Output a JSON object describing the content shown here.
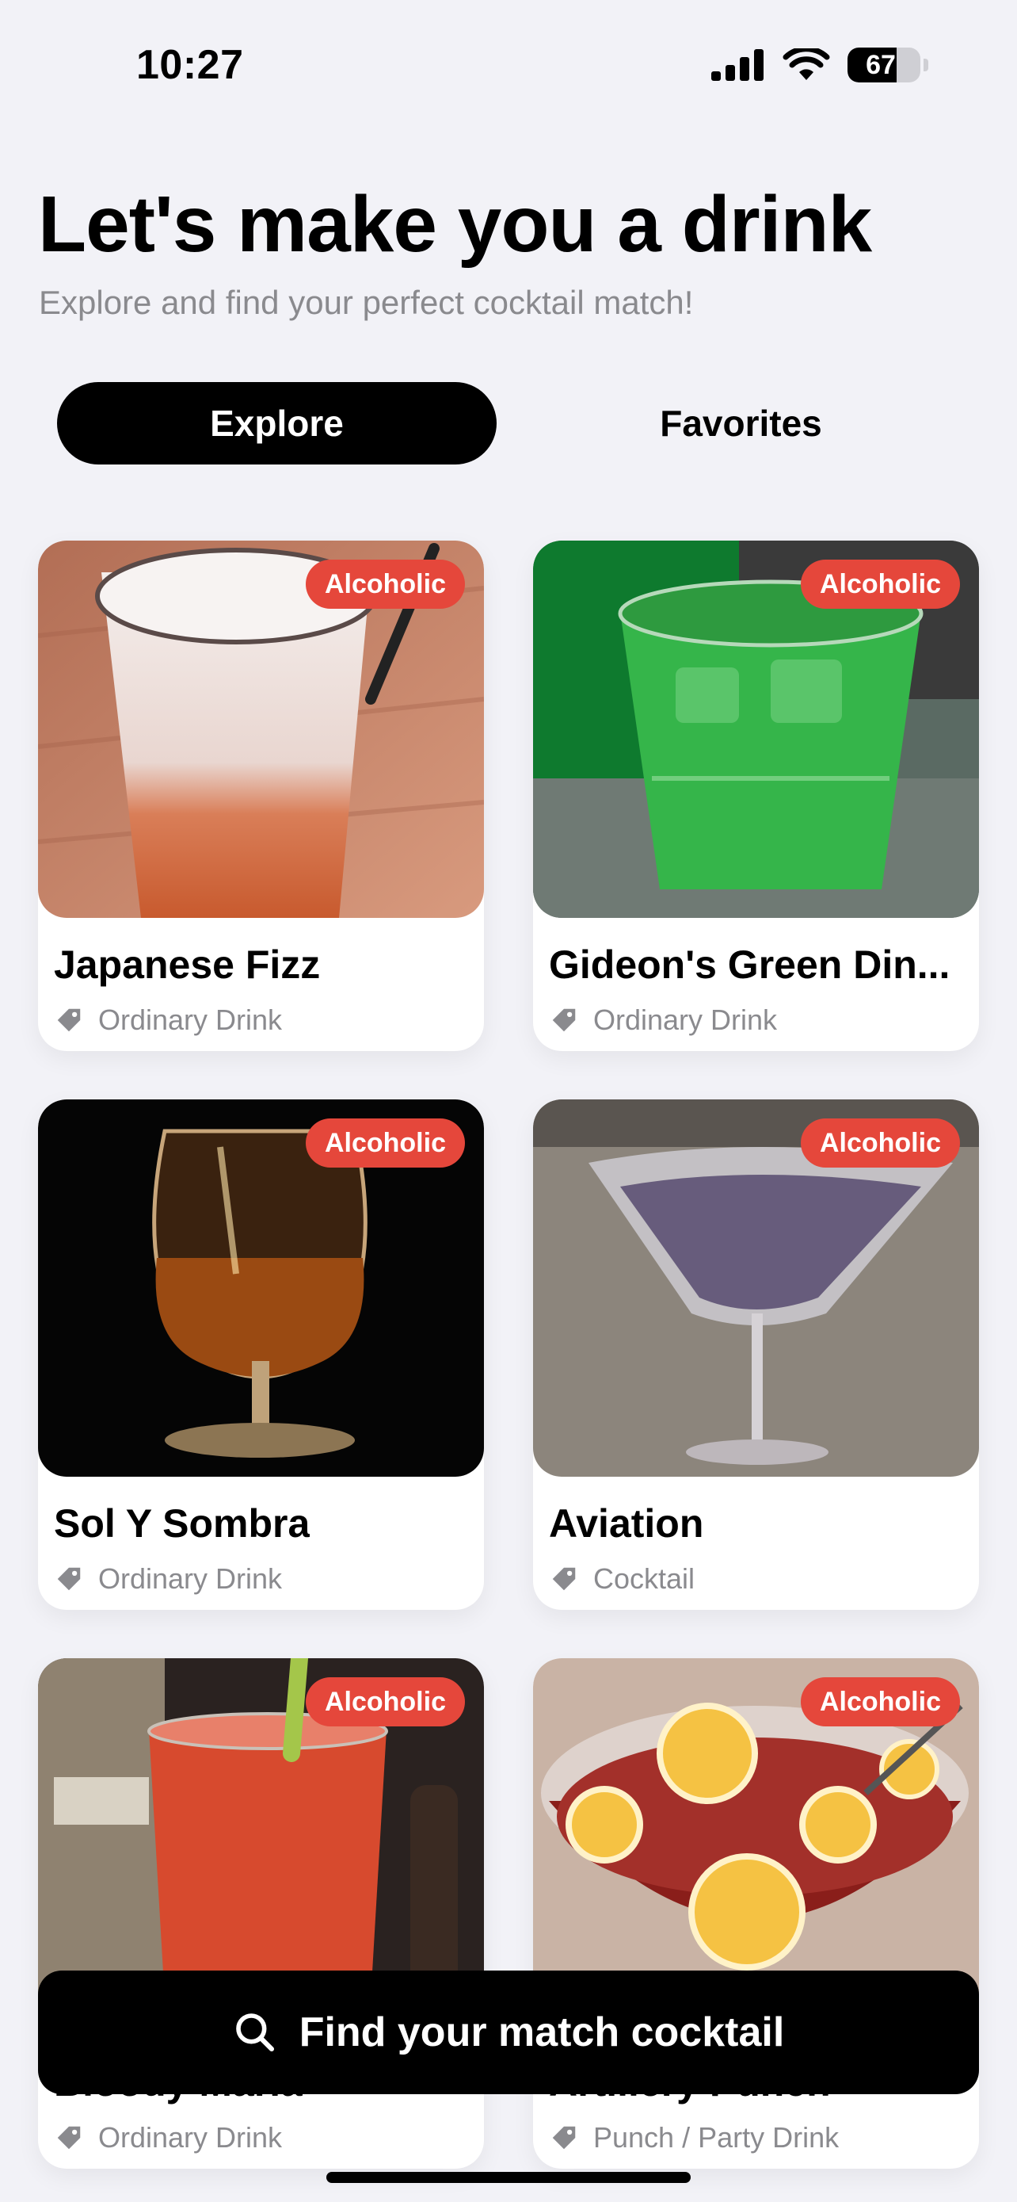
{
  "status_bar": {
    "time": "10:27",
    "battery_level": "67",
    "icons": [
      "cellular-signal-icon",
      "wifi-icon",
      "battery-icon"
    ]
  },
  "header": {
    "title": "Let's make you a drink",
    "subtitle": "Explore and find your perfect cocktail match!"
  },
  "tabs": [
    {
      "label": "Explore",
      "selected": true
    },
    {
      "label": "Favorites",
      "selected": false
    }
  ],
  "cocktails": [
    {
      "name": "Japanese Fizz",
      "category": "Ordinary Drink",
      "badge": "Alcoholic"
    },
    {
      "name": "Gideon's Green Din...",
      "category": "Ordinary Drink",
      "badge": "Alcoholic"
    },
    {
      "name": "Sol Y Sombra",
      "category": "Ordinary Drink",
      "badge": "Alcoholic"
    },
    {
      "name": "Aviation",
      "category": "Cocktail",
      "badge": "Alcoholic"
    },
    {
      "name": "Bloody Maria",
      "category": "Ordinary Drink",
      "badge": "Alcoholic"
    },
    {
      "name": "Artillery Punch",
      "category": "Punch / Party Drink",
      "badge": "Alcoholic"
    }
  ],
  "cta": {
    "label": "Find your match cocktail",
    "icon": "search-icon"
  },
  "colors": {
    "background": "#F2F2F7",
    "badge": "#E5473B",
    "primary": "#000000",
    "secondary_text": "#8A8A8E"
  }
}
